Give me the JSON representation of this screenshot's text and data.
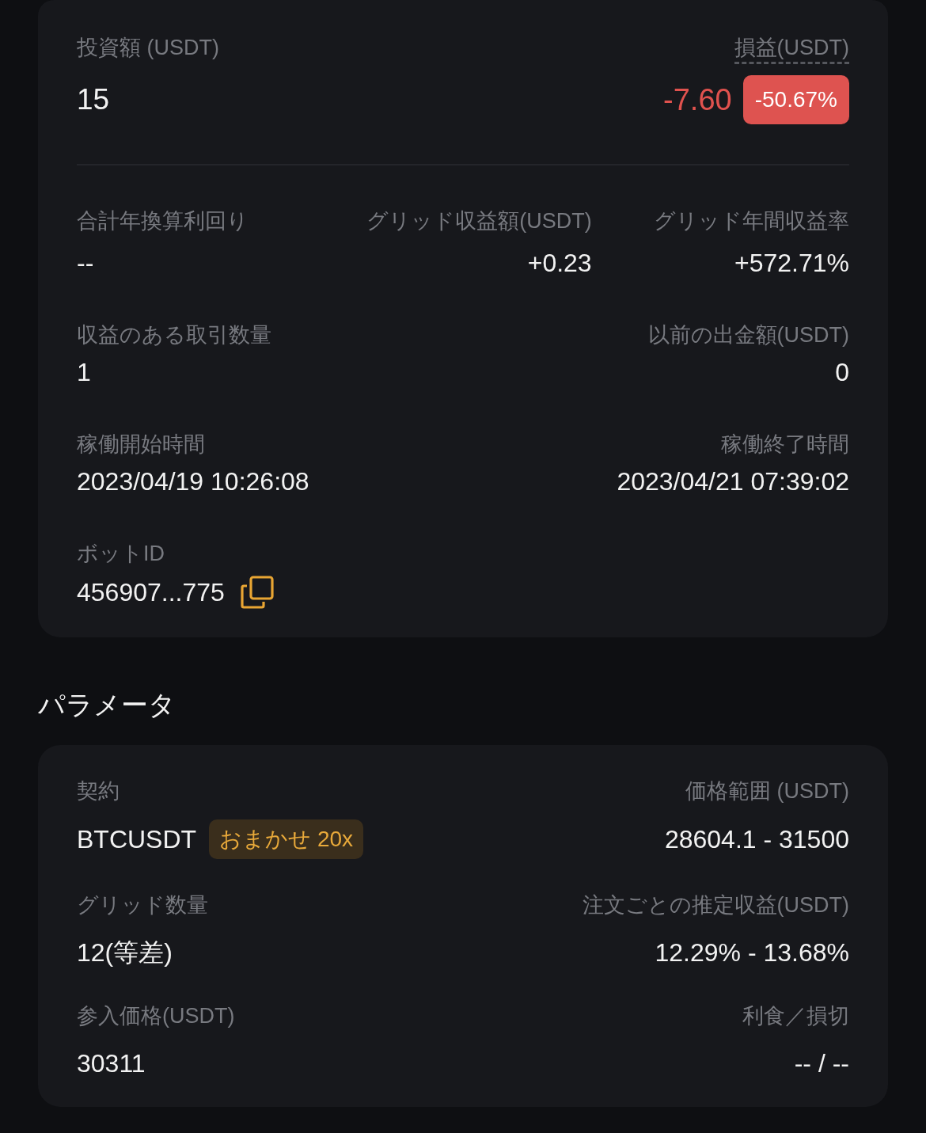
{
  "summary": {
    "investment": {
      "label": "投資額 (USDT)",
      "value": "15"
    },
    "pnl": {
      "label": "損益(USDT)",
      "value": "-7.60",
      "percent": "-50.67%"
    },
    "returns": [
      {
        "label": "合計年換算利回り",
        "value": "--"
      },
      {
        "label": "グリッド収益額(USDT)",
        "value": "+0.23"
      },
      {
        "label": "グリッド年間収益率",
        "value": "+572.71%"
      }
    ],
    "details": [
      [
        {
          "label": "収益のある取引数量",
          "value": "1"
        },
        {
          "label": "以前の出金額(USDT)",
          "value": "0"
        }
      ],
      [
        {
          "label": "稼働開始時間",
          "value": "2023/04/19 10:26:08"
        },
        {
          "label": "稼働終了時間",
          "value": "2023/04/21 07:39:02"
        }
      ]
    ],
    "bot_id": {
      "label": "ボットID",
      "value": "456907...775"
    }
  },
  "parameters": {
    "title": "パラメータ",
    "rows": [
      [
        {
          "label": "契約",
          "value": "BTCUSDT",
          "badge": "おまかせ 20x"
        },
        {
          "label": "価格範囲 (USDT)",
          "value": "28604.1 - 31500"
        }
      ],
      [
        {
          "label": "グリッド数量",
          "value": "12(等差)"
        },
        {
          "label": "注文ごとの推定収益(USDT)",
          "value": "12.29% - 13.68%"
        }
      ],
      [
        {
          "label": "参入価格(USDT)",
          "value": "30311"
        },
        {
          "label": "利食／損切",
          "value": "-- / --"
        }
      ]
    ]
  }
}
